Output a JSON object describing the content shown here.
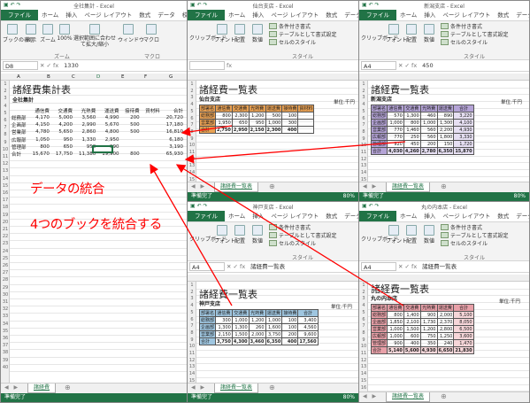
{
  "ribbon_tabs_main": [
    "ファイル",
    "ホーム",
    "挿入",
    "ページ レイアウト",
    "数式",
    "データ",
    "校閲"
  ],
  "ribbon_tabs_short": [
    "ファイル",
    "ホーム",
    "挿入",
    "ページ レイアウト",
    "数式",
    "データ"
  ],
  "colors": {
    "excel_green": "#217346",
    "arrow_red": "#ff0000",
    "hdr_orange": "#e8a052",
    "hdr_purple": "#b4a3d6",
    "hdr_blue": "#9fc6e0",
    "hdr_pink": "#e8a0a8"
  },
  "main": {
    "title": "全社集計 - Excel",
    "view_group": {
      "items": [
        "ブックの表示",
        "表示",
        "ズーム",
        "100%",
        "選択範囲に合わせて拡大/縮小",
        "ウィンドウ",
        "マクロ"
      ],
      "group_zoom": "ズーム",
      "group_macro": "マクロ"
    },
    "namebox": "D8",
    "formula": "1330",
    "col_headers": [
      "A",
      "B",
      "C",
      "D",
      "E",
      "F",
      "G"
    ],
    "sheet_title": "諸経費集計表",
    "subtitle": "全社集計",
    "header": [
      "通信費",
      "交通費",
      "光熱費",
      "運送費",
      "接待費",
      "資材料",
      "合計"
    ],
    "rows": [
      {
        "name": "総務部",
        "v": [
          "4,170",
          "5,000",
          "3,560",
          "4,990",
          "200",
          "20,720"
        ]
      },
      {
        "name": "企画部",
        "v": [
          "4,150",
          "4,200",
          "2,990",
          "5,670",
          "500",
          "17,180"
        ]
      },
      {
        "name": "営業部",
        "v": [
          "4,780",
          "5,650",
          "2,860",
          "4,800",
          "500",
          "16,810"
        ]
      },
      {
        "name": "広報部",
        "v": [
          "1,050",
          "950",
          "1,330",
          "2,950",
          "",
          "6,180"
        ]
      },
      {
        "name": "管理部",
        "v": [
          "800",
          "650",
          "950",
          "990",
          "",
          "3,190"
        ]
      },
      {
        "name": "合計",
        "v": [
          "15,670",
          "17,750",
          "11,380",
          "19,900",
          "800",
          "65,930"
        ]
      }
    ],
    "sheet_tab": "諸経費",
    "status": "準備完了"
  },
  "tr1": {
    "title": "仙台支店 - Excel",
    "groups": [
      "クリップボード",
      "フォント",
      "配置",
      "数値"
    ],
    "styles": [
      "条件付き書式",
      "テーブルとして書式設定",
      "セルのスタイル"
    ],
    "group_style": "スタイル",
    "sheet_title": "諸経費一覧表",
    "subtitle": "仙台支店",
    "unit": "単位:千円",
    "header": [
      "部署名",
      "通信費",
      "交通費",
      "光熱費",
      "運送費",
      "接待費",
      "資材料"
    ],
    "rows": [
      {
        "name": "総務部",
        "v": [
          "800",
          "2,300",
          "1,200",
          "500",
          "100"
        ]
      },
      {
        "name": "営業部",
        "v": [
          "1,950",
          "650",
          "950",
          "1,000",
          "300"
        ]
      },
      {
        "name": "合計",
        "v": [
          "2,750",
          "2,950",
          "2,150",
          "2,300",
          "400"
        ]
      }
    ],
    "sheet_tab": "諸経費一覧表",
    "status": "準備完了",
    "zoom": "80%"
  },
  "tr2": {
    "title": "新潟支店 - Excel",
    "namebox": "A4",
    "formula": "450",
    "sheet_title": "諸経費一覧表",
    "subtitle": "新潟支店",
    "unit": "単位:千円",
    "header": [
      "部署名",
      "通信費",
      "交通費",
      "光熱費",
      "運送費",
      "合計"
    ],
    "rows": [
      {
        "name": "総務部",
        "v": [
          "570",
          "1,300",
          "460",
          "890",
          "3,220"
        ]
      },
      {
        "name": "企画部",
        "v": [
          "1,000",
          "800",
          "1,000",
          "1,300",
          "4,100"
        ]
      },
      {
        "name": "営業部",
        "v": [
          "770",
          "1,460",
          "560",
          "2,200",
          "4,930"
        ]
      },
      {
        "name": "広報部",
        "v": [
          "770",
          "250",
          "560",
          "1,800",
          "3,330"
        ]
      },
      {
        "name": "管理部",
        "v": [
          "920",
          "450",
          "200",
          "150",
          "1,720"
        ]
      },
      {
        "name": "合計",
        "v": [
          "4,030",
          "4,260",
          "2,780",
          "6,350",
          "15,870"
        ]
      }
    ],
    "sheet_tab": "諸経費一覧表",
    "status": "準備完了",
    "zoom": "80%"
  },
  "br1": {
    "title": "神戸支店 - Excel",
    "namebox": "A4",
    "formula": "諸経費一覧表",
    "sheet_title": "諸経費一覧表",
    "subtitle": "神戸支店",
    "unit": "単位:千円",
    "header": [
      "部署名",
      "通信費",
      "交通費",
      "光熱費",
      "運送費",
      "接待費",
      "合計"
    ],
    "rows": [
      {
        "name": "総務部",
        "v": [
          "300",
          "1,000",
          "1,200",
          "1,000",
          "100",
          "3,400"
        ]
      },
      {
        "name": "企画部",
        "v": [
          "1,300",
          "1,300",
          "260",
          "1,600",
          "100",
          "4,560"
        ]
      },
      {
        "name": "営業部",
        "v": [
          "2,150",
          "1,500",
          "2,000",
          "3,750",
          "200",
          "9,600"
        ]
      },
      {
        "name": "合計",
        "v": [
          "3,750",
          "4,300",
          "3,460",
          "6,350",
          "400",
          "17,560"
        ]
      }
    ],
    "sheet_tab": "諸経費一覧表",
    "status": "準備完了",
    "zoom": "80%"
  },
  "br2": {
    "title": "丸の内本店 - Excel",
    "namebox": "A4",
    "formula": "諸経費一覧表",
    "sheet_title": "諸経費一覧表",
    "subtitle": "丸の内本店",
    "unit": "単位:千円",
    "header": [
      "部署名",
      "通信費",
      "交通費",
      "光熱費",
      "運送費",
      "合計"
    ],
    "rows": [
      {
        "name": "総務部",
        "v": [
          "800",
          "1,400",
          "900",
          "2,000",
          "5,100"
        ]
      },
      {
        "name": "企画部",
        "v": [
          "1,850",
          "2,100",
          "1,730",
          "2,370",
          "8,050"
        ]
      },
      {
        "name": "営業部",
        "v": [
          "1,000",
          "1,500",
          "1,200",
          "2,800",
          "6,500"
        ]
      },
      {
        "name": "広報部",
        "v": [
          "1,000",
          "600",
          "750",
          "1,250",
          "3,600"
        ]
      },
      {
        "name": "管理部",
        "v": [
          "900",
          "400",
          "350",
          "240",
          "1,470"
        ]
      },
      {
        "name": "合計",
        "v": [
          "5,140",
          "5,600",
          "4,930",
          "6,650",
          "21,830"
        ]
      }
    ],
    "sheet_tab": "諸経費一覧表"
  },
  "annotation": {
    "line1": "データの統合",
    "line2": "4つのブックを統合する"
  }
}
